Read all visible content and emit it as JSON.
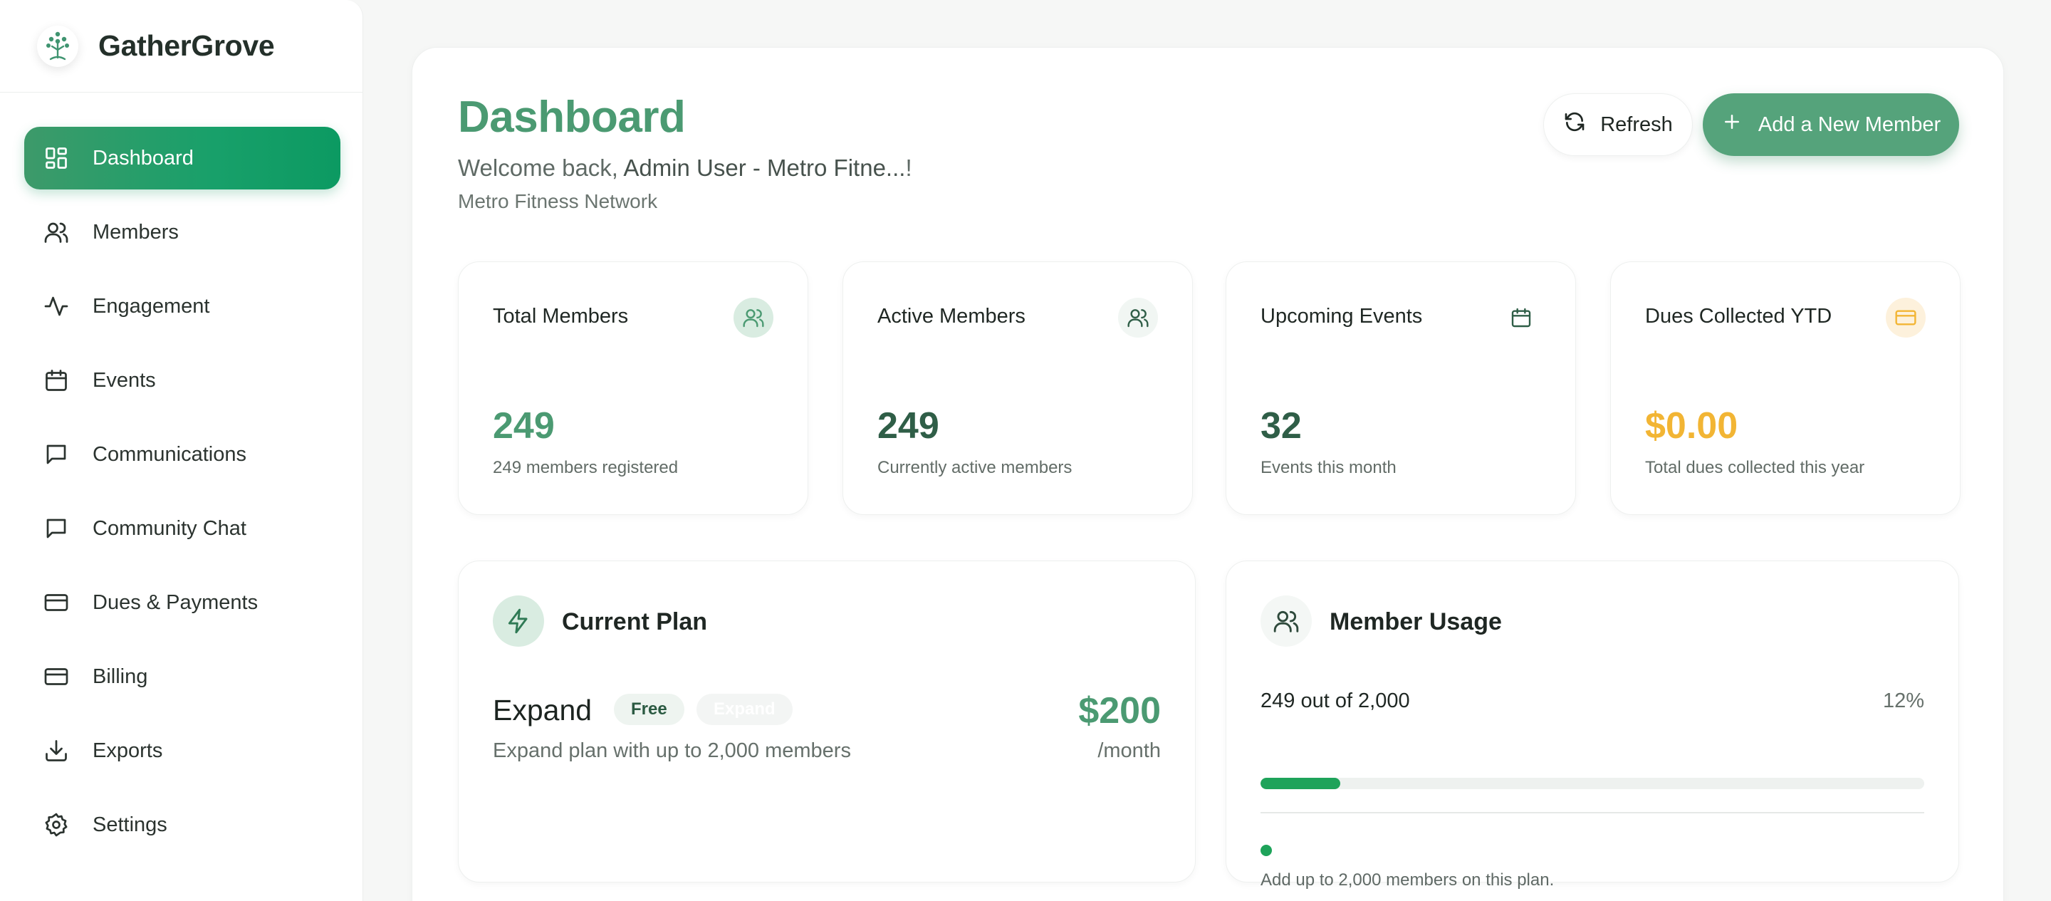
{
  "brand": {
    "name": "GatherGrove"
  },
  "sidebar": {
    "items": [
      {
        "label": "Dashboard",
        "icon": "dashboard-icon",
        "active": true
      },
      {
        "label": "Members",
        "icon": "users-icon"
      },
      {
        "label": "Engagement",
        "icon": "activity-icon"
      },
      {
        "label": "Events",
        "icon": "calendar-icon"
      },
      {
        "label": "Communications",
        "icon": "message-icon"
      },
      {
        "label": "Community Chat",
        "icon": "message-icon"
      },
      {
        "label": "Dues & Payments",
        "icon": "credit-card-icon"
      },
      {
        "label": "Billing",
        "icon": "credit-card-icon"
      },
      {
        "label": "Exports",
        "icon": "download-icon"
      },
      {
        "label": "Settings",
        "icon": "gear-icon"
      }
    ]
  },
  "header": {
    "title": "Dashboard",
    "welcome_prefix": "Welcome back, ",
    "welcome_user": "Admin User - Metro Fitne...",
    "welcome_suffix": "!",
    "org": "Metro Fitness Network",
    "refresh_label": "Refresh",
    "add_member_label": "Add a New Member"
  },
  "stats": [
    {
      "title": "Total Members",
      "value": "249",
      "desc": "249 members registered",
      "icon": "users-icon",
      "value_color": "#4b9a72"
    },
    {
      "title": "Active Members",
      "value": "249",
      "desc": "Currently active members",
      "icon": "users-icon",
      "value_color": "#2f5e47"
    },
    {
      "title": "Upcoming Events",
      "value": "32",
      "desc": "Events this month",
      "icon": "calendar-icon",
      "value_color": "#2f5e47"
    },
    {
      "title": "Dues Collected YTD",
      "value": "$0.00",
      "desc": "Total dues collected this year",
      "icon": "credit-card-icon",
      "value_color": "#f2b534"
    }
  ],
  "plan": {
    "title": "Current Plan",
    "name": "Expand",
    "badge_free": "Free",
    "badge_expand": "Expand",
    "desc": "Expand plan with up to 2,000 members",
    "price": "$200",
    "period": "/month"
  },
  "usage": {
    "title": "Member Usage",
    "count_text": "249 out of 2,000",
    "percent_text": "12%",
    "percent": 12,
    "note": "Add up to 2,000 members on this plan."
  },
  "colors": {
    "accent": "#4b9a72",
    "progress": "#1ea35a",
    "gold": "#f2b534"
  }
}
